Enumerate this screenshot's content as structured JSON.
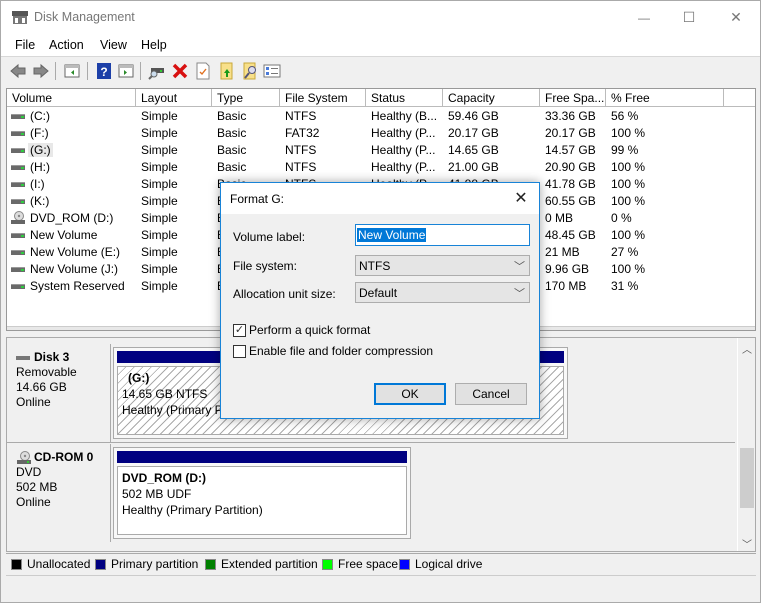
{
  "window": {
    "title": "Disk Management",
    "controls": {
      "minimize": "—",
      "maximize": "☐",
      "close": "✕"
    }
  },
  "menu": [
    "File",
    "Action",
    "View",
    "Help"
  ],
  "toolbar": {
    "icons": [
      "back-icon",
      "forward-icon",
      "show-hide-console-tree-icon",
      "help-icon",
      "show-hide-action-pane-icon",
      "connect-drive-icon",
      "delete-icon",
      "properties-icon",
      "open-folder-icon",
      "explore-icon",
      "settings-list-icon"
    ]
  },
  "volume_list": {
    "columns": [
      "Volume",
      "Layout",
      "Type",
      "File System",
      "Status",
      "Capacity",
      "Free Spa...",
      "% Free"
    ],
    "rows": [
      {
        "volume": "(C:)",
        "layout": "Simple",
        "type": "Basic",
        "fs": "NTFS",
        "status": "Healthy (B...",
        "capacity": "59.46 GB",
        "free": "33.36 GB",
        "pct": "56 %",
        "icon": "drive"
      },
      {
        "volume": "(F:)",
        "layout": "Simple",
        "type": "Basic",
        "fs": "FAT32",
        "status": "Healthy (P...",
        "capacity": "20.17 GB",
        "free": "20.17 GB",
        "pct": "100 %",
        "icon": "drive"
      },
      {
        "volume": "(G:)",
        "layout": "Simple",
        "type": "Basic",
        "fs": "NTFS",
        "status": "Healthy (P...",
        "capacity": "14.65 GB",
        "free": "14.57 GB",
        "pct": "99 %",
        "icon": "drive",
        "selected": true
      },
      {
        "volume": "(H:)",
        "layout": "Simple",
        "type": "Basic",
        "fs": "NTFS",
        "status": "Healthy (P...",
        "capacity": "21.00 GB",
        "free": "20.90 GB",
        "pct": "100 %",
        "icon": "drive"
      },
      {
        "volume": "(I:)",
        "layout": "Simple",
        "type": "Basic",
        "fs": "NTFS",
        "status": "Healthy (P...",
        "capacity": "41.88 GB",
        "free": "41.78 GB",
        "pct": "100 %",
        "icon": "drive"
      },
      {
        "volume": "(K:)",
        "layout": "Simple",
        "type": "B",
        "fs": "",
        "status": "",
        "capacity": "",
        "free": "60.55 GB",
        "pct": "100 %",
        "icon": "drive"
      },
      {
        "volume": "DVD_ROM (D:)",
        "layout": "Simple",
        "type": "B",
        "fs": "",
        "status": "",
        "capacity": "",
        "free": "0 MB",
        "pct": "0 %",
        "icon": "cd"
      },
      {
        "volume": "New Volume",
        "layout": "Simple",
        "type": "B",
        "fs": "",
        "status": "",
        "capacity": "",
        "free": "48.45 GB",
        "pct": "100 %",
        "icon": "drive"
      },
      {
        "volume": "New Volume (E:)",
        "layout": "Simple",
        "type": "B",
        "fs": "",
        "status": "",
        "capacity": "",
        "free": "21 MB",
        "pct": "27 %",
        "icon": "drive"
      },
      {
        "volume": "New Volume (J:)",
        "layout": "Simple",
        "type": "B",
        "fs": "",
        "status": "",
        "capacity": "",
        "free": "9.96 GB",
        "pct": "100 %",
        "icon": "drive"
      },
      {
        "volume": "System Reserved",
        "layout": "Simple",
        "type": "B",
        "fs": "",
        "status": "",
        "capacity": "",
        "free": "170 MB",
        "pct": "31 %",
        "icon": "drive"
      }
    ]
  },
  "disks": [
    {
      "name": "Disk 3",
      "kind": "Removable",
      "size": "14.66 GB",
      "state": "Online",
      "partition": {
        "title": "(G:)",
        "line1": "14.65 GB NTFS",
        "line2": "Healthy (Primary Pa"
      }
    },
    {
      "name": "CD-ROM 0",
      "kind": "DVD",
      "size": "502 MB",
      "state": "Online",
      "partition": {
        "title": "DVD_ROM  (D:)",
        "line1": "502 MB UDF",
        "line2": "Healthy (Primary Partition)"
      }
    }
  ],
  "legend": [
    {
      "label": "Unallocated",
      "color": "#000000"
    },
    {
      "label": "Primary partition",
      "color": "#000080"
    },
    {
      "label": "Extended partition",
      "color": "#008000"
    },
    {
      "label": "Free space",
      "color": "#00ff00"
    },
    {
      "label": "Logical drive",
      "color": "#0000ff"
    }
  ],
  "dialog": {
    "title": "Format G:",
    "volume_label_label": "Volume label:",
    "volume_label_value": "New Volume",
    "file_system_label": "File system:",
    "file_system_value": "NTFS",
    "alloc_label": "Allocation unit size:",
    "alloc_value": "Default",
    "quick_format_label": "Perform a quick format",
    "quick_format_checked": true,
    "compression_label": "Enable file and folder compression",
    "compression_checked": false,
    "ok_label": "OK",
    "cancel_label": "Cancel",
    "close_glyph": "✕"
  }
}
